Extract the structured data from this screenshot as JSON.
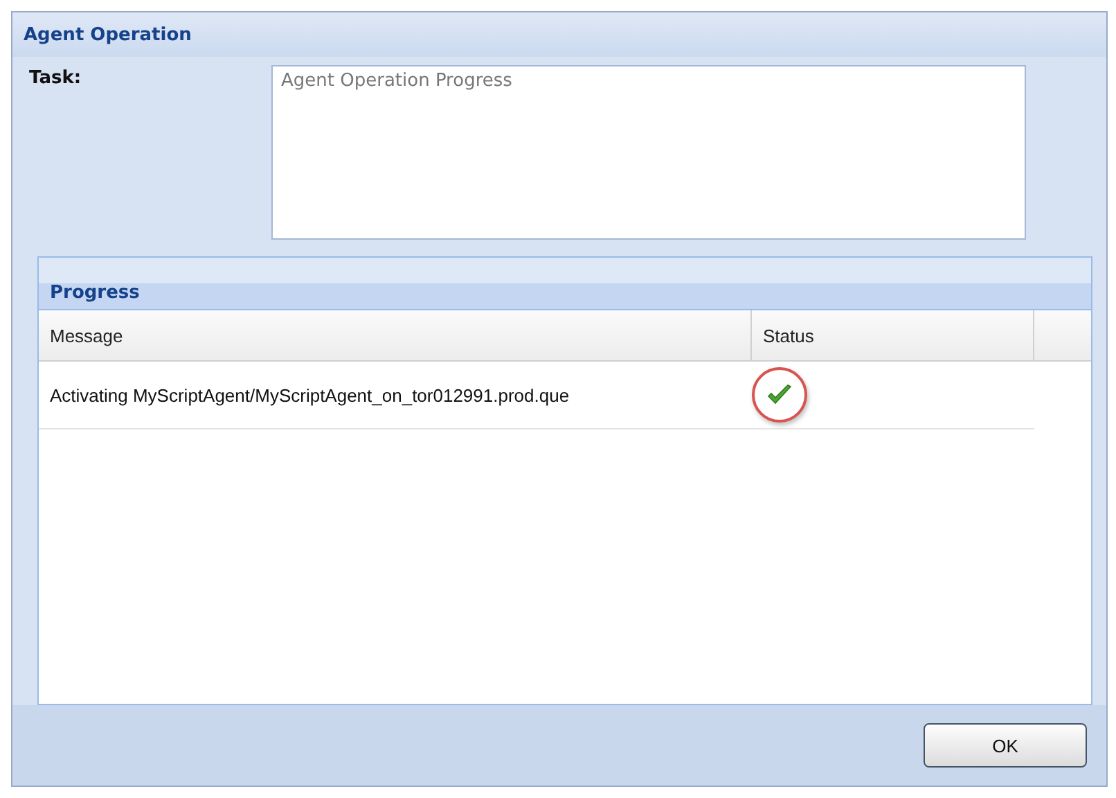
{
  "window": {
    "title": "Agent Operation"
  },
  "task": {
    "label": "Task:",
    "value": "Agent Operation Progress"
  },
  "progress": {
    "title": "Progress",
    "columns": [
      "Message",
      "Status"
    ],
    "rows": [
      {
        "message": "Activating MyScriptAgent/MyScriptAgent_on_tor012991.prod.que",
        "completed": true,
        "highlighted": true
      }
    ]
  },
  "buttons": [
    "OK"
  ]
}
